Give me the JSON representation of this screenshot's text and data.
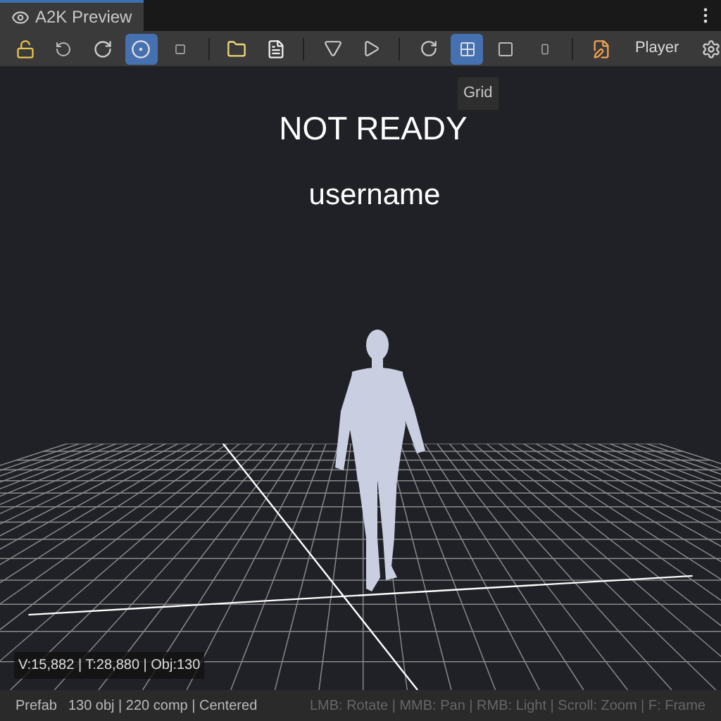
{
  "tab": {
    "title": "A2K Preview",
    "selected": true
  },
  "toolbar": {
    "buttons": [
      {
        "selected": false
      },
      {
        "selected": false
      },
      {
        "selected": false
      },
      {
        "selected": true
      },
      {
        "selected": false
      },
      {
        "selected": false
      },
      {
        "selected": false
      },
      {
        "selected": false
      },
      {
        "selected": false
      },
      {
        "selected": false
      },
      {
        "selected": true
      },
      {
        "selected": false
      },
      {
        "selected": false
      },
      {
        "selected": false
      }
    ],
    "player_label": "Player"
  },
  "tooltip": "Grid",
  "viewport": {
    "status": "NOT READY",
    "username": "username",
    "stats": "V:15,882 | T:28,880 | Obj:130"
  },
  "status_bar": {
    "type": "Prefab",
    "summary": "130 obj | 220 comp | Centered",
    "hints": "LMB: Rotate | MMB: Pan | RMB: Light | Scroll: Zoom | F: Frame"
  }
}
